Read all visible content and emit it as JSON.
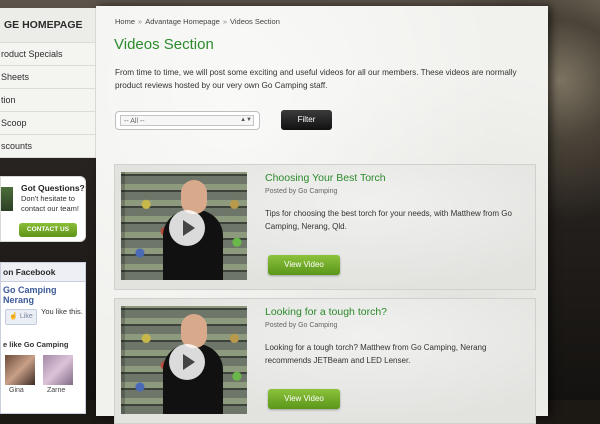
{
  "sidebar": {
    "heading": "GE HOMEPAGE",
    "items": [
      {
        "label": "roduct Specials"
      },
      {
        "label": "Sheets"
      },
      {
        "label": "tion"
      },
      {
        "label": "Scoop"
      },
      {
        "label": "scounts"
      }
    ],
    "questions": {
      "title": "Got Questions?",
      "text": "Don't hesitate to contact our team!",
      "button": "CONTACT US"
    },
    "facebook": {
      "heading": "on Facebook",
      "page_name": "Go Camping Nerang",
      "like_button": "Like",
      "you_like": "You like this.",
      "people_like": "e like Go Camping",
      "fans": [
        {
          "name": "Gina"
        },
        {
          "name": "Zarne"
        }
      ]
    }
  },
  "breadcrumb": {
    "items": [
      "Home",
      "Advantage Homepage",
      "Videos Section"
    ],
    "separator": "»"
  },
  "page": {
    "title": "Videos Section",
    "intro": "From time to time, we will post some exciting and useful videos for all our members. These videos are normally product reviews hosted by our very own Go Camping staff."
  },
  "filter": {
    "select_value": "-- All --",
    "button": "Filter"
  },
  "videos": [
    {
      "title": "Choosing Your Best Torch",
      "meta": "Posted by Go Camping",
      "description": "Tips for choosing the best torch for your needs, with Matthew from Go Camping, Nerang, Qld.",
      "button": "View Video"
    },
    {
      "title": "Looking for a tough torch?",
      "meta": "Posted by Go Camping",
      "description": "Looking for a tough torch? Matthew from Go Camping, Nerang recommends JETBeam and LED Lenser.",
      "button": "View Video"
    }
  ],
  "colors": {
    "accent_green": "#2c8a2c",
    "button_green": "#6aa624",
    "facebook_blue": "#3b5998"
  }
}
